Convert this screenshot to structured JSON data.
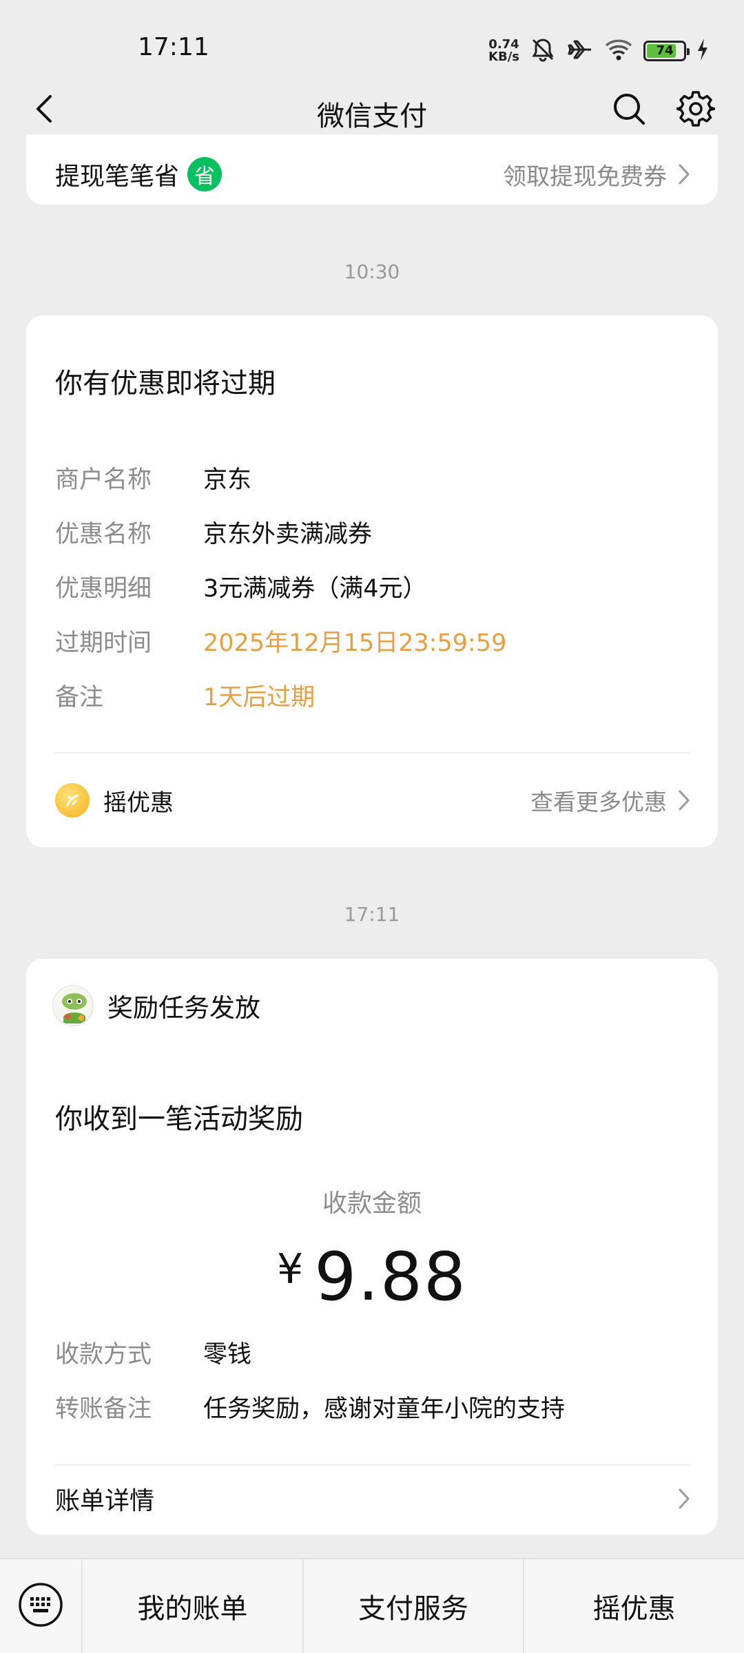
{
  "status_bar": {
    "time": "17:11",
    "net_speed_value": "0.74",
    "net_speed_unit": "KB/s",
    "battery_level": "74",
    "icons": [
      "mute-icon",
      "airplane-icon",
      "wifi-icon",
      "battery-icon",
      "charging-icon"
    ]
  },
  "header": {
    "title": "微信支付",
    "icons": [
      "back-icon",
      "search-icon",
      "gear-icon"
    ]
  },
  "promo_card": {
    "left_text": "提现笔笔省",
    "badge": "省",
    "right_text": "领取提现免费券"
  },
  "messages": [
    {
      "timestamp": "10:30",
      "title": "你有优惠即将过期",
      "rows": [
        {
          "label": "商户名称",
          "value": "京东"
        },
        {
          "label": "优惠名称",
          "value": "京东外卖满减券"
        },
        {
          "label": "优惠明细",
          "value": "3元满减券（满4元）"
        },
        {
          "label": "过期时间",
          "value": "2025年12月15日23:59:59"
        },
        {
          "label": "备注",
          "value": "1天后过期"
        }
      ],
      "footer_left": "摇优惠",
      "footer_right": "查看更多优惠"
    },
    {
      "timestamp": "17:11",
      "sender": "奖励任务发放",
      "title": "你收到一笔活动奖励",
      "amount_label": "收款金额",
      "currency_symbol": "¥",
      "amount": "9.88",
      "rows": [
        {
          "label": "收款方式",
          "value": "零钱"
        },
        {
          "label": "转账备注",
          "value": "任务奖励，感谢对童年小院的支持"
        }
      ],
      "footer_left": "账单详情"
    }
  ],
  "bottom_bar": {
    "tabs": [
      "我的账单",
      "支付服务",
      "摇优惠"
    ]
  },
  "colors": {
    "background": "#ededed",
    "card": "#ffffff",
    "wechat_green": "#07c160",
    "highlight_orange": "#e5a043",
    "muted_text": "#8c8c8c"
  }
}
